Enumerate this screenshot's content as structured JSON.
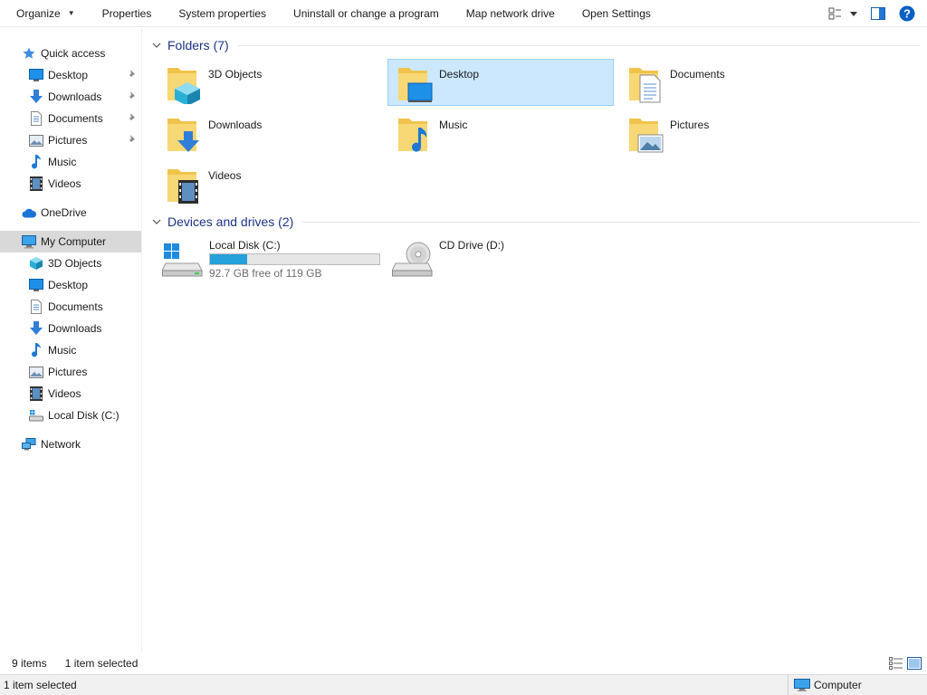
{
  "toolbar": {
    "organize": "Organize",
    "properties": "Properties",
    "system_properties": "System properties",
    "uninstall": "Uninstall or change a program",
    "map_drive": "Map network drive",
    "open_settings": "Open Settings"
  },
  "sidebar": {
    "quick_access": "Quick access",
    "quick_items": [
      {
        "label": "Desktop",
        "pinned": true
      },
      {
        "label": "Downloads",
        "pinned": true
      },
      {
        "label": "Documents",
        "pinned": true
      },
      {
        "label": "Pictures",
        "pinned": true
      },
      {
        "label": "Music",
        "pinned": false
      },
      {
        "label": "Videos",
        "pinned": false
      }
    ],
    "onedrive": "OneDrive",
    "my_computer": "My Computer",
    "computer_items": [
      {
        "label": "3D Objects"
      },
      {
        "label": "Desktop"
      },
      {
        "label": "Documents"
      },
      {
        "label": "Downloads"
      },
      {
        "label": "Music"
      },
      {
        "label": "Pictures"
      },
      {
        "label": "Videos"
      },
      {
        "label": "Local Disk (C:)"
      }
    ],
    "network": "Network"
  },
  "folders_group": {
    "title": "Folders (7)",
    "items": [
      {
        "label": "3D Objects",
        "icon": "folder-3d-objects-icon",
        "selected": false
      },
      {
        "label": "Desktop",
        "icon": "folder-desktop-icon",
        "selected": true
      },
      {
        "label": "Documents",
        "icon": "folder-documents-icon",
        "selected": false
      },
      {
        "label": "Downloads",
        "icon": "folder-downloads-icon",
        "selected": false
      },
      {
        "label": "Music",
        "icon": "folder-music-icon",
        "selected": false
      },
      {
        "label": "Pictures",
        "icon": "folder-pictures-icon",
        "selected": false
      },
      {
        "label": "Videos",
        "icon": "folder-videos-icon",
        "selected": false
      }
    ]
  },
  "drives_group": {
    "title": "Devices and drives (2)",
    "items": [
      {
        "label": "Local Disk (C:)",
        "free_text": "92.7 GB free of 119 GB",
        "used_fraction": 0.22,
        "icon": "local-disk-icon"
      },
      {
        "label": "CD Drive (D:)",
        "icon": "cd-drive-icon"
      }
    ]
  },
  "status": {
    "item_count": "9 items",
    "selected_count": "1 item selected",
    "bottom_selected": "1 item selected",
    "zone": "Computer"
  },
  "colors": {
    "selection_bg": "#cce8ff",
    "selection_border": "#99d1ff",
    "group_title": "#1e3287",
    "drive_bar": "#26a0da",
    "folder_yellow": "#f8d775"
  }
}
